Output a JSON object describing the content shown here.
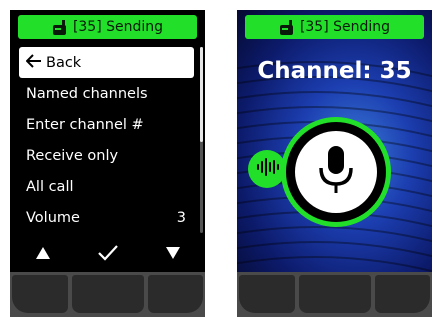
{
  "left_screen": {
    "status": {
      "icon": "radio-handset-icon",
      "text": "[35] Sending"
    },
    "menu": [
      {
        "label": "Back",
        "icon": "arrow-left-icon",
        "value": "",
        "selected": true
      },
      {
        "label": "Named channels",
        "value": ""
      },
      {
        "label": "Enter channel #",
        "value": ""
      },
      {
        "label": "Receive only",
        "value": ""
      },
      {
        "label": "All call",
        "value": ""
      },
      {
        "label": "Volume",
        "value": "3"
      }
    ],
    "soft_keys": [
      "up-arrow-icon",
      "check-icon",
      "down-arrow-icon"
    ]
  },
  "right_screen": {
    "status": {
      "icon": "radio-handset-icon",
      "text": "[35] Sending"
    },
    "channel_label": "Channel: 35",
    "ptt_icon": "microphone-icon",
    "voice_indicator": "waveform-icon"
  },
  "colors": {
    "accent": "#22e02a",
    "device": "#000000",
    "hardware": "#4a4a4a"
  }
}
